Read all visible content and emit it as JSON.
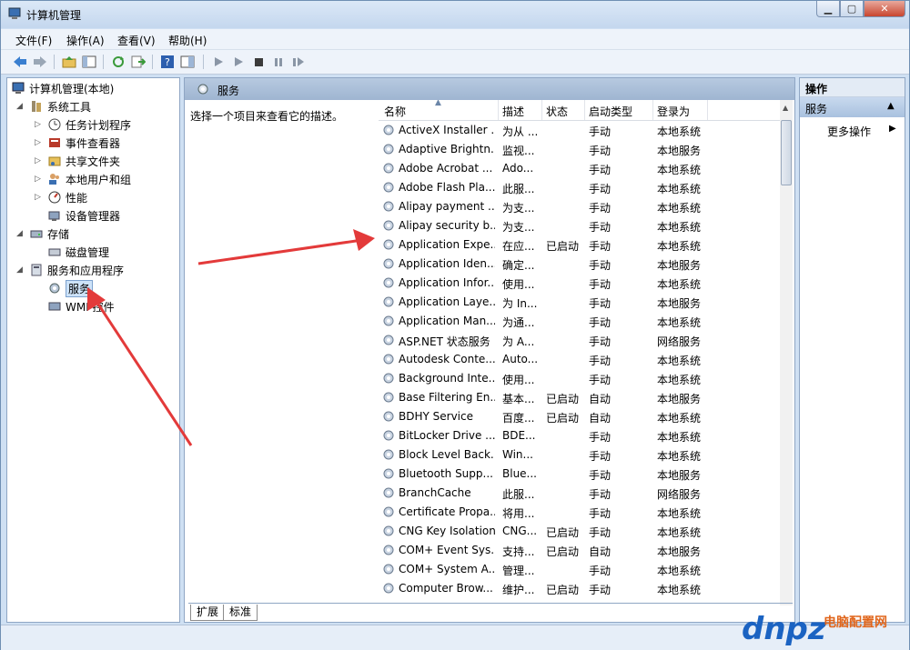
{
  "window": {
    "title": "计算机管理"
  },
  "menu": [
    "文件(F)",
    "操作(A)",
    "查看(V)",
    "帮助(H)"
  ],
  "tree": {
    "root": "计算机管理(本地)",
    "system_tools": "系统工具",
    "task_scheduler": "任务计划程序",
    "event_viewer": "事件查看器",
    "shared_folders": "共享文件夹",
    "local_users": "本地用户和组",
    "performance": "性能",
    "device_manager": "设备管理器",
    "storage": "存储",
    "disk_management": "磁盘管理",
    "services_apps": "服务和应用程序",
    "services": "服务",
    "wmi": "WMI 控件"
  },
  "center": {
    "title": "服务",
    "description": "选择一个项目来查看它的描述。",
    "columns": [
      "名称",
      "描述",
      "状态",
      "启动类型",
      "登录为"
    ],
    "tabs": [
      "扩展",
      "标准"
    ]
  },
  "services": [
    {
      "name": "ActiveX Installer ...",
      "desc": "为从 ...",
      "status": "",
      "startup": "手动",
      "logon": "本地系统"
    },
    {
      "name": "Adaptive Brightn...",
      "desc": "监视...",
      "status": "",
      "startup": "手动",
      "logon": "本地服务"
    },
    {
      "name": "Adobe Acrobat ...",
      "desc": "Ado...",
      "status": "",
      "startup": "手动",
      "logon": "本地系统"
    },
    {
      "name": "Adobe Flash Pla...",
      "desc": "此服...",
      "status": "",
      "startup": "手动",
      "logon": "本地系统"
    },
    {
      "name": "Alipay payment ...",
      "desc": "为支...",
      "status": "",
      "startup": "手动",
      "logon": "本地系统"
    },
    {
      "name": "Alipay security b...",
      "desc": "为支...",
      "status": "",
      "startup": "手动",
      "logon": "本地系统"
    },
    {
      "name": "Application Expe...",
      "desc": "在应...",
      "status": "已启动",
      "startup": "手动",
      "logon": "本地系统"
    },
    {
      "name": "Application Iden...",
      "desc": "确定...",
      "status": "",
      "startup": "手动",
      "logon": "本地服务"
    },
    {
      "name": "Application Infor...",
      "desc": "使用...",
      "status": "",
      "startup": "手动",
      "logon": "本地系统"
    },
    {
      "name": "Application Laye...",
      "desc": "为 In...",
      "status": "",
      "startup": "手动",
      "logon": "本地服务"
    },
    {
      "name": "Application Man...",
      "desc": "为通...",
      "status": "",
      "startup": "手动",
      "logon": "本地系统"
    },
    {
      "name": "ASP.NET 状态服务",
      "desc": "为 A...",
      "status": "",
      "startup": "手动",
      "logon": "网络服务"
    },
    {
      "name": "Autodesk Conte...",
      "desc": "Auto...",
      "status": "",
      "startup": "手动",
      "logon": "本地系统"
    },
    {
      "name": "Background Inte...",
      "desc": "使用...",
      "status": "",
      "startup": "手动",
      "logon": "本地系统"
    },
    {
      "name": "Base Filtering En...",
      "desc": "基本...",
      "status": "已启动",
      "startup": "自动",
      "logon": "本地服务"
    },
    {
      "name": "BDHY Service",
      "desc": "百度...",
      "status": "已启动",
      "startup": "自动",
      "logon": "本地系统"
    },
    {
      "name": "BitLocker Drive ...",
      "desc": "BDE...",
      "status": "",
      "startup": "手动",
      "logon": "本地系统"
    },
    {
      "name": "Block Level Back...",
      "desc": "Win...",
      "status": "",
      "startup": "手动",
      "logon": "本地系统"
    },
    {
      "name": "Bluetooth Supp...",
      "desc": "Blue...",
      "status": "",
      "startup": "手动",
      "logon": "本地服务"
    },
    {
      "name": "BranchCache",
      "desc": "此服...",
      "status": "",
      "startup": "手动",
      "logon": "网络服务"
    },
    {
      "name": "Certificate Propa...",
      "desc": "将用...",
      "status": "",
      "startup": "手动",
      "logon": "本地系统"
    },
    {
      "name": "CNG Key Isolation",
      "desc": "CNG...",
      "status": "已启动",
      "startup": "手动",
      "logon": "本地系统"
    },
    {
      "name": "COM+ Event Sys...",
      "desc": "支持...",
      "status": "已启动",
      "startup": "自动",
      "logon": "本地服务"
    },
    {
      "name": "COM+ System A...",
      "desc": "管理...",
      "status": "",
      "startup": "手动",
      "logon": "本地系统"
    },
    {
      "name": "Computer Brow...",
      "desc": "维护...",
      "status": "已启动",
      "startup": "手动",
      "logon": "本地系统"
    }
  ],
  "actions": {
    "header": "操作",
    "section": "服务",
    "more": "更多操作"
  },
  "watermark": {
    "brand": "dnpz",
    "site": "电脑配置网"
  }
}
